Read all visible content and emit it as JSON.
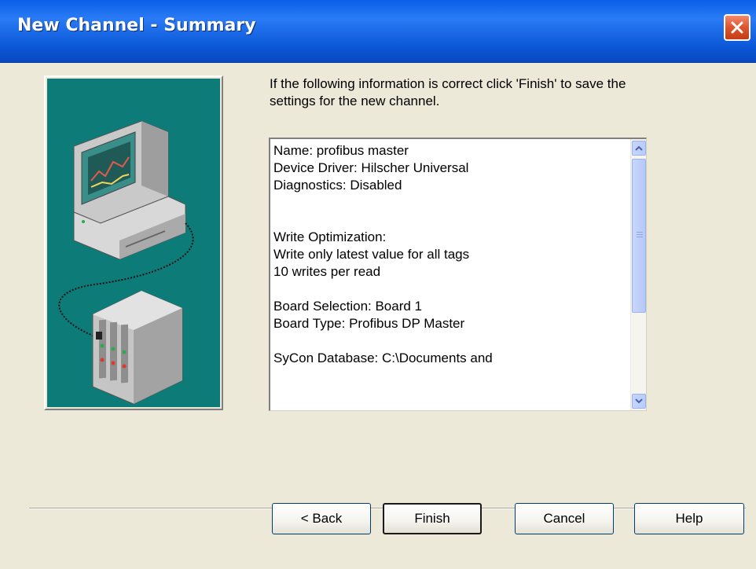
{
  "window": {
    "title": "New Channel - Summary",
    "close_icon": "close-x-icon"
  },
  "illustration": {
    "description_icon": "computer-network-icon",
    "background": "#0d7b78"
  },
  "intro_text": "If the following information is correct click 'Finish' to save the settings for the new channel.",
  "summary_lines": [
    "Name: profibus master",
    "Device Driver: Hilscher Universal",
    "Diagnostics: Disabled",
    "",
    "",
    "Write Optimization:",
    "Write only latest value for all tags",
    "10 writes per read",
    "",
    "Board Selection: Board 1",
    "Board Type: Profibus DP Master",
    "",
    "SyCon Database: C:\\Documents and"
  ],
  "buttons": {
    "back": "< Back",
    "finish": "Finish",
    "cancel": "Cancel",
    "help": "Help"
  },
  "colors": {
    "titlebar": "#0a5fe8",
    "dialog_bg": "#ece9d8",
    "close_button": "#e0532d"
  }
}
